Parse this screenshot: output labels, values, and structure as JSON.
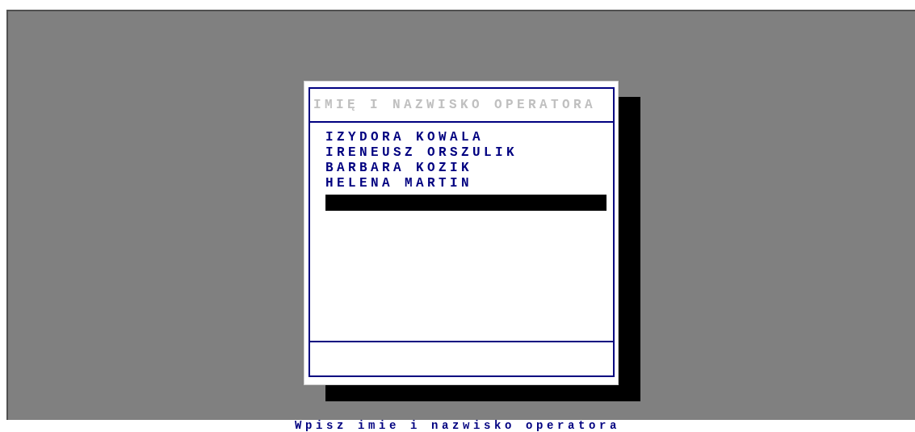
{
  "dialog": {
    "title": "IMIĘ I NAZWISKO OPERATORA",
    "operators": [
      {
        "name": "IZYDORA KOWALA"
      },
      {
        "name": "IRENEUSZ ORSZULIK"
      },
      {
        "name": "BARBARA KOZIK"
      },
      {
        "name": "HELENA MARTIN"
      }
    ]
  },
  "status_bar": {
    "text": "Wpisz imie i nazwisko operatora"
  }
}
